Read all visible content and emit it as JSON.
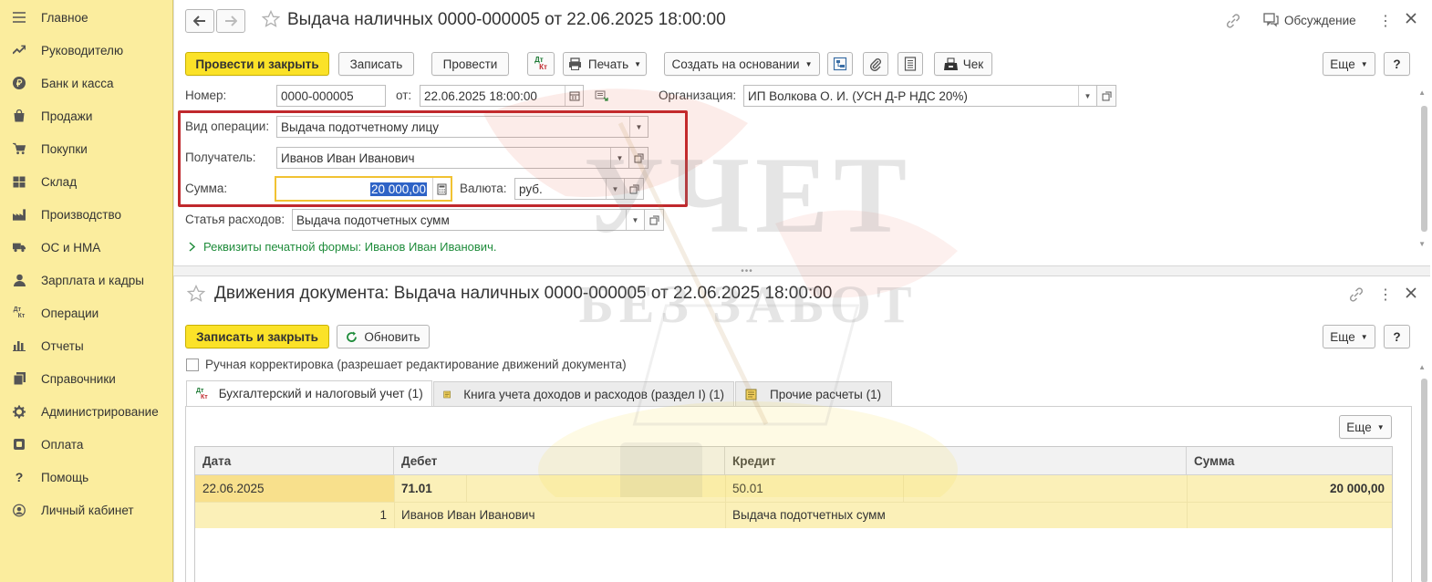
{
  "sidebar": {
    "items": [
      {
        "label": "Главное",
        "icon": "menu-icon"
      },
      {
        "label": "Руководителю",
        "icon": "trend-icon"
      },
      {
        "label": "Банк и касса",
        "icon": "ruble-icon"
      },
      {
        "label": "Продажи",
        "icon": "bag-icon"
      },
      {
        "label": "Покупки",
        "icon": "cart-icon"
      },
      {
        "label": "Склад",
        "icon": "warehouse-icon"
      },
      {
        "label": "Производство",
        "icon": "factory-icon"
      },
      {
        "label": "ОС и НМА",
        "icon": "truck-icon"
      },
      {
        "label": "Зарплата и кадры",
        "icon": "person-icon"
      },
      {
        "label": "Операции",
        "icon": "dt-kt-icon"
      },
      {
        "label": "Отчеты",
        "icon": "bar-chart-icon"
      },
      {
        "label": "Справочники",
        "icon": "books-icon"
      },
      {
        "label": "Администрирование",
        "icon": "gear-icon"
      },
      {
        "label": "Оплата",
        "icon": "payment-icon"
      },
      {
        "label": "Помощь",
        "icon": "question-icon"
      },
      {
        "label": "Личный кабинет",
        "icon": "account-icon"
      }
    ]
  },
  "doc": {
    "title": "Выдача наличных 0000-000005 от 22.06.2025 18:00:00",
    "discussion_label": "Обсуждение",
    "toolbar": {
      "post_close": "Провести и закрыть",
      "save": "Записать",
      "post": "Провести",
      "print": "Печать",
      "create_based": "Создать на основании",
      "receipt": "Чек",
      "more": "Еще",
      "help": "?"
    },
    "dtkt_top": "Дт",
    "dtkt_bottom": "Кт",
    "number_label": "Номер:",
    "number_value": "0000-000005",
    "date_label": "от:",
    "date_value": "22.06.2025 18:00:00",
    "org_label": "Организация:",
    "org_value": "ИП Волкова О. И. (УСН Д-Р НДС 20%)",
    "op_label": "Вид операции:",
    "op_value": "Выдача подотчетному лицу",
    "recipient_label": "Получатель:",
    "recipient_value": "Иванов Иван Иванович",
    "sum_label": "Сумма:",
    "sum_value": "20 000,00",
    "currency_label": "Валюта:",
    "currency_value": "руб.",
    "expense_label": "Статья расходов:",
    "expense_value": "Выдача подотчетных сумм",
    "print_details": "Реквизиты печатной формы: Иванов Иван Иванович."
  },
  "movements": {
    "title": "Движения документа: Выдача наличных 0000-000005 от 22.06.2025 18:00:00",
    "save_close": "Записать и закрыть",
    "refresh": "Обновить",
    "more": "Еще",
    "help": "?",
    "manual_edit": "Ручная корректировка (разрешает редактирование движений документа)",
    "tabs": [
      "Бухгалтерский и налоговый учет (1)",
      "Книга учета доходов и расходов (раздел I) (1)",
      "Прочие расчеты (1)"
    ],
    "table_more": "Еще",
    "columns": [
      "Дата",
      "Дебет",
      "Кредит",
      "Сумма"
    ],
    "row": {
      "date": "22.06.2025",
      "num": "1",
      "debit": "71.01",
      "debit_sub": "Иванов Иван Иванович",
      "credit": "50.01",
      "credit_sub": "Выдача подотчетных сумм",
      "sum": "20 000,00"
    }
  },
  "watermark": {
    "line1": "УЧЕТ",
    "line2": "БЕЗ ЗАБОТ"
  },
  "colors": {
    "sidebar_bg": "#fbed9e",
    "primary_button": "#fbe228",
    "highlight_border": "#c0282d",
    "active_row": "#fbe9a4",
    "link_green": "#1f8c3b"
  }
}
